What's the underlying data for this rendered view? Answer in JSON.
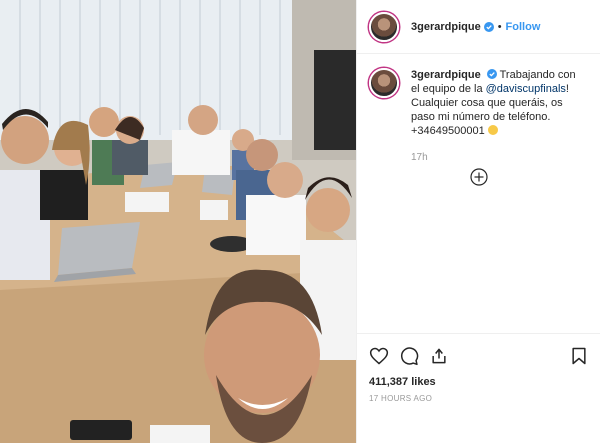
{
  "post": {
    "username": "3gerardpique",
    "follow_label": "Follow",
    "separator": "•",
    "caption": {
      "username": "3gerardpique",
      "text_before": "Trabajando con el equipo de la",
      "mention": "@daviscupfinals",
      "text_after": "! Cualquier cosa que queráis, os paso mi número de teléfono. +34649500001"
    },
    "relative_time": "17h",
    "likes": "411,387 likes",
    "posted_ago": "17 HOURS AGO"
  },
  "icons": {
    "verified": "verified-badge-icon",
    "add_comment": "plus-circle-icon",
    "like": "heart-icon",
    "comment": "comment-bubble-icon",
    "share": "share-icon",
    "save": "bookmark-icon"
  },
  "colors": {
    "link_blue": "#3897f0",
    "mention": "#003569",
    "muted": "#999999",
    "text": "#262626",
    "story_ring": "#c13584"
  }
}
